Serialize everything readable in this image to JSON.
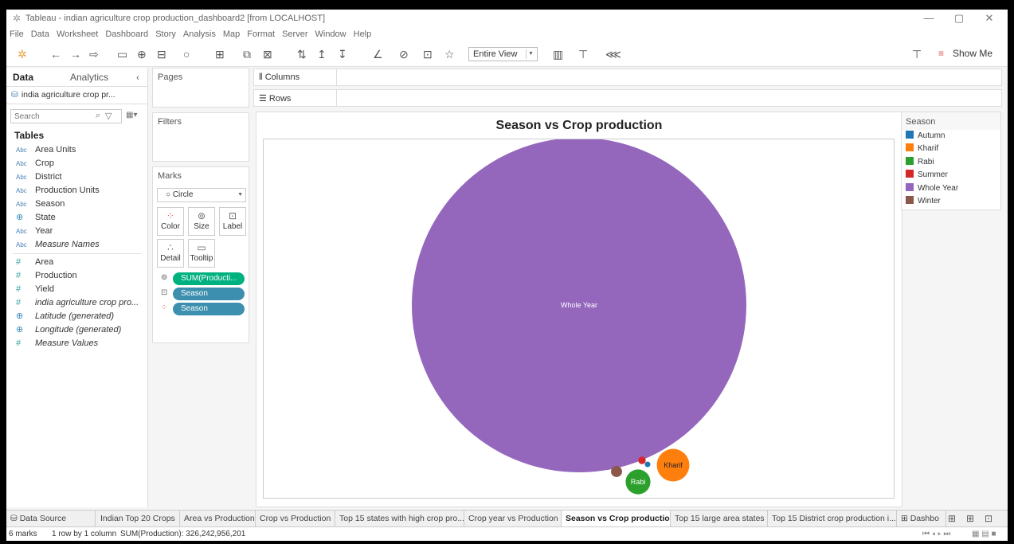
{
  "window": {
    "title": "Tableau - indian agriculture crop production_dashboard2 [from LOCALHOST]"
  },
  "menu": [
    "File",
    "Data",
    "Worksheet",
    "Dashboard",
    "Story",
    "Analysis",
    "Map",
    "Format",
    "Server",
    "Window",
    "Help"
  ],
  "toolbar": {
    "fit": "Entire View",
    "show_me": "Show Me"
  },
  "data_pane": {
    "tab_data": "Data",
    "tab_analytics": "Analytics",
    "source": "india agriculture crop pr...",
    "search_placeholder": "Search",
    "tables_heading": "Tables",
    "dimensions": [
      {
        "type": "Abc",
        "name": "Area Units"
      },
      {
        "type": "Abc",
        "name": "Crop"
      },
      {
        "type": "Abc",
        "name": "District"
      },
      {
        "type": "Abc",
        "name": "Production Units"
      },
      {
        "type": "Abc",
        "name": "Season"
      },
      {
        "type": "geo",
        "name": "State"
      },
      {
        "type": "Abc",
        "name": "Year"
      },
      {
        "type": "Abc",
        "name": "Measure Names"
      }
    ],
    "measures": [
      {
        "type": "#",
        "name": "Area"
      },
      {
        "type": "#",
        "name": "Production"
      },
      {
        "type": "#",
        "name": "Yield"
      },
      {
        "type": "#",
        "name": "india agriculture crop pro..."
      },
      {
        "type": "geo",
        "name": "Latitude (generated)"
      },
      {
        "type": "geo",
        "name": "Longitude (generated)"
      },
      {
        "type": "#",
        "name": "Measure Values"
      }
    ]
  },
  "cards": {
    "pages": "Pages",
    "filters": "Filters",
    "marks": "Marks",
    "mark_type": "Circle",
    "buttons": {
      "color": "Color",
      "size": "Size",
      "label": "Label",
      "detail": "Detail",
      "tooltip": "Tooltip"
    },
    "pills": [
      "SUM(Producti...",
      "Season",
      "Season"
    ]
  },
  "shelves": {
    "columns": "Columns",
    "rows": "Rows"
  },
  "chart_data": {
    "type": "packed bubble",
    "title": "Season vs Crop production",
    "size_measure": "SUM(Production)",
    "labels_shown": [
      "Whole Year",
      "Kharif",
      "Rabi"
    ],
    "legend_title": "Season",
    "legend": [
      {
        "name": "Autumn",
        "color": "#1f77b4"
      },
      {
        "name": "Kharif",
        "color": "#ff7f0e"
      },
      {
        "name": "Rabi",
        "color": "#2ca02c"
      },
      {
        "name": "Summer",
        "color": "#d62728"
      },
      {
        "name": "Whole Year",
        "color": "#9467bd"
      },
      {
        "name": "Winter",
        "color": "#8c564b"
      }
    ],
    "relative_size_estimate": {
      "Whole Year": 1.0,
      "Kharif": 0.0095,
      "Rabi": 0.0055,
      "Winter": 0.0011,
      "Summer": 0.0005,
      "Autumn": 0.0001
    }
  },
  "sheet_tabs": [
    "Data Source",
    "Indian Top 20 Crops",
    "Area vs Production",
    "Crop vs Production",
    "Top 15 states with high crop pro...",
    "Crop year vs Production",
    "Season vs Crop production",
    "Top 15 large area states",
    "Top 15 District crop production i...",
    "Dashbo"
  ],
  "active_tab": "Season vs Crop production",
  "status": {
    "marks": "6 marks",
    "rows": "1 row by 1 column",
    "sum": "SUM(Production): 326,242,956,201"
  }
}
